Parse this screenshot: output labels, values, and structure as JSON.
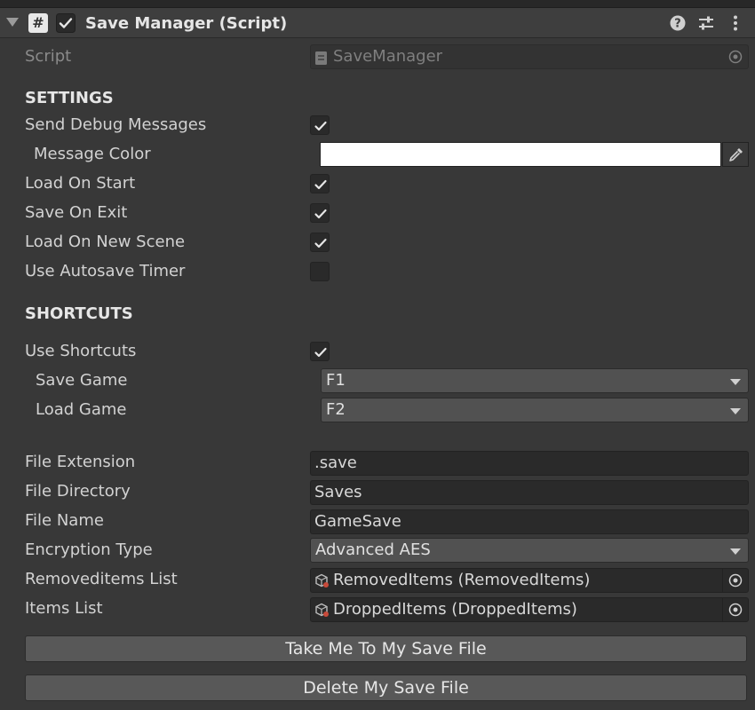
{
  "header": {
    "title": "Save Manager (Script)",
    "script_icon_glyph": "#",
    "enabled": true
  },
  "script_row": {
    "label": "Script",
    "value": "SaveManager"
  },
  "settings": {
    "section_title": "SETTINGS",
    "send_debug_messages": {
      "label": "Send Debug Messages",
      "checked": true
    },
    "message_color": {
      "label": "Message Color",
      "color": "#ffffff"
    },
    "load_on_start": {
      "label": "Load On Start",
      "checked": true
    },
    "save_on_exit": {
      "label": "Save On Exit",
      "checked": true
    },
    "load_on_new_scene": {
      "label": "Load On New Scene",
      "checked": true
    },
    "use_autosave_timer": {
      "label": "Use Autosave Timer",
      "checked": false
    }
  },
  "shortcuts": {
    "section_title": "SHORTCUTS",
    "use_shortcuts": {
      "label": "Use Shortcuts",
      "checked": true
    },
    "save_game": {
      "label": "Save Game",
      "value": "F1"
    },
    "load_game": {
      "label": "Load Game",
      "value": "F2"
    }
  },
  "file": {
    "extension": {
      "label": "File Extension",
      "value": ".save"
    },
    "directory": {
      "label": "File Directory",
      "value": "Saves"
    },
    "name": {
      "label": "File Name",
      "value": "GameSave"
    },
    "encryption": {
      "label": "Encryption Type",
      "value": "Advanced AES"
    },
    "removed_items": {
      "label": "Removeditems List",
      "value": "RemovedItems (RemovedItems)"
    },
    "items": {
      "label": "Items List",
      "value": "DroppedItems (DroppedItems)"
    }
  },
  "buttons": {
    "take_me": "Take Me To My Save File",
    "delete": "Delete My Save File"
  },
  "colors": {
    "background": "#383838",
    "header": "#3e3e3e",
    "field": "#2a2a2a",
    "button": "#585858",
    "text": "#d2d2d2"
  }
}
